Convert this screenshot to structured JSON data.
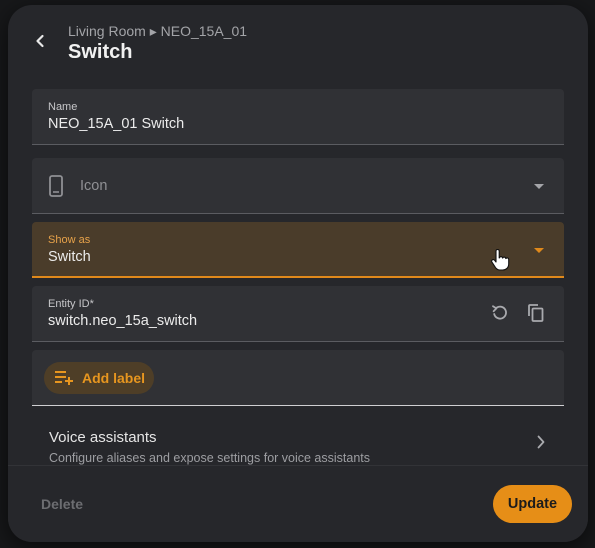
{
  "header": {
    "breadcrumb": "Living Room ▸ NEO_15A_01",
    "title": "Switch"
  },
  "fields": {
    "name": {
      "label": "Name",
      "value": "NEO_15A_01 Switch"
    },
    "icon": {
      "placeholder": "Icon"
    },
    "show_as": {
      "label": "Show as",
      "value": "Switch"
    },
    "entity_id": {
      "label": "Entity ID*",
      "value": "switch.neo_15a_switch"
    }
  },
  "labels": {
    "add_label": "Add label"
  },
  "voice_assistants": {
    "title": "Voice assistants",
    "subtitle": "Configure aliases and expose settings for voice assistants"
  },
  "footer": {
    "delete_label": "Delete",
    "update_label": "Update"
  },
  "colors": {
    "accent": "#e68e17",
    "surface": "#26272b",
    "field": "#303135"
  }
}
